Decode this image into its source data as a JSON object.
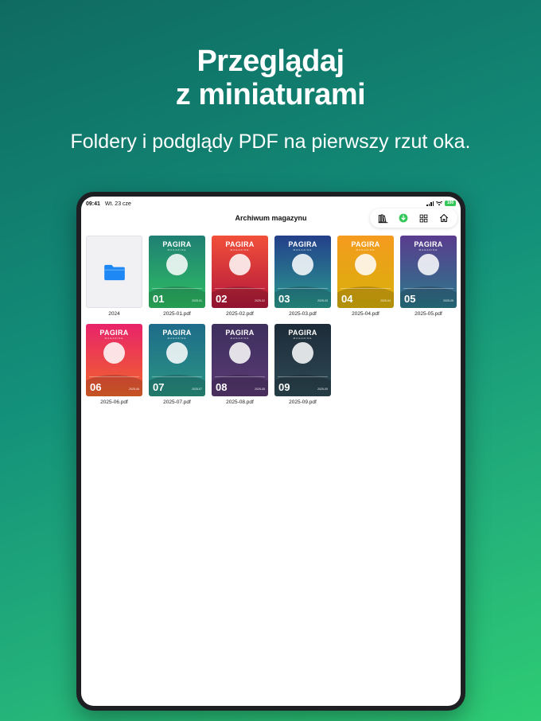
{
  "headline": {
    "line1": "Przeglądaj",
    "line2": "z miniaturami"
  },
  "subline": "Foldery i podglądy PDF na pierwszy rzut oka.",
  "statusbar": {
    "time": "09:41",
    "date": "Wt. 23 cze",
    "battery": "100"
  },
  "nav": {
    "title": "Archiwum magazynu",
    "toolbar": [
      {
        "name": "library-icon"
      },
      {
        "name": "download-icon",
        "color": "#34c759"
      },
      {
        "name": "grid-view-icon"
      },
      {
        "name": "home-icon"
      }
    ]
  },
  "folder": {
    "label": "2024",
    "icon": "folder-icon",
    "color": "#1e88f5"
  },
  "covers": [
    {
      "file": "2025-01.pdf",
      "number": "01",
      "date": "2025-01",
      "brand": "PAGIRA",
      "sub": "MAGAZINE",
      "c1": "#1f7f73",
      "c2": "#2fbf63"
    },
    {
      "file": "2025-02.pdf",
      "number": "02",
      "date": "2025-02",
      "brand": "PAGIRA",
      "sub": "MAGAZINE",
      "c1": "#f2503a",
      "c2": "#b2173b"
    },
    {
      "file": "2025-03.pdf",
      "number": "03",
      "date": "2025-03",
      "brand": "PAGIRA",
      "sub": "MAGAZINE",
      "c1": "#243f8a",
      "c2": "#2a9a8f"
    },
    {
      "file": "2025-04.pdf",
      "number": "04",
      "date": "2025-04",
      "brand": "PAGIRA",
      "sub": "MAGAZINE",
      "c1": "#f59b1f",
      "c2": "#d8b10a"
    },
    {
      "file": "2025-05.pdf",
      "number": "05",
      "date": "2025-05",
      "brand": "PAGIRA",
      "sub": "MAGAZINE",
      "c1": "#5a3c8f",
      "c2": "#2b7a8a"
    },
    {
      "file": "2025-06.pdf",
      "number": "06",
      "date": "2025-06",
      "brand": "PAGIRA",
      "sub": "MAGAZINE",
      "c1": "#e9236a",
      "c2": "#f0662a"
    },
    {
      "file": "2025-07.pdf",
      "number": "07",
      "date": "2025-07",
      "brand": "PAGIRA",
      "sub": "MAGAZINE",
      "c1": "#1e6b8a",
      "c2": "#2a9582"
    },
    {
      "file": "2025-08.pdf",
      "number": "08",
      "date": "2025-08",
      "brand": "PAGIRA",
      "sub": "MAGAZINE",
      "c1": "#3d2f5e",
      "c2": "#5a3a73"
    },
    {
      "file": "2025-09.pdf",
      "number": "09",
      "date": "2025-09",
      "brand": "PAGIRA",
      "sub": "MAGAZINE",
      "c1": "#1d2b38",
      "c2": "#2d4a55"
    }
  ]
}
